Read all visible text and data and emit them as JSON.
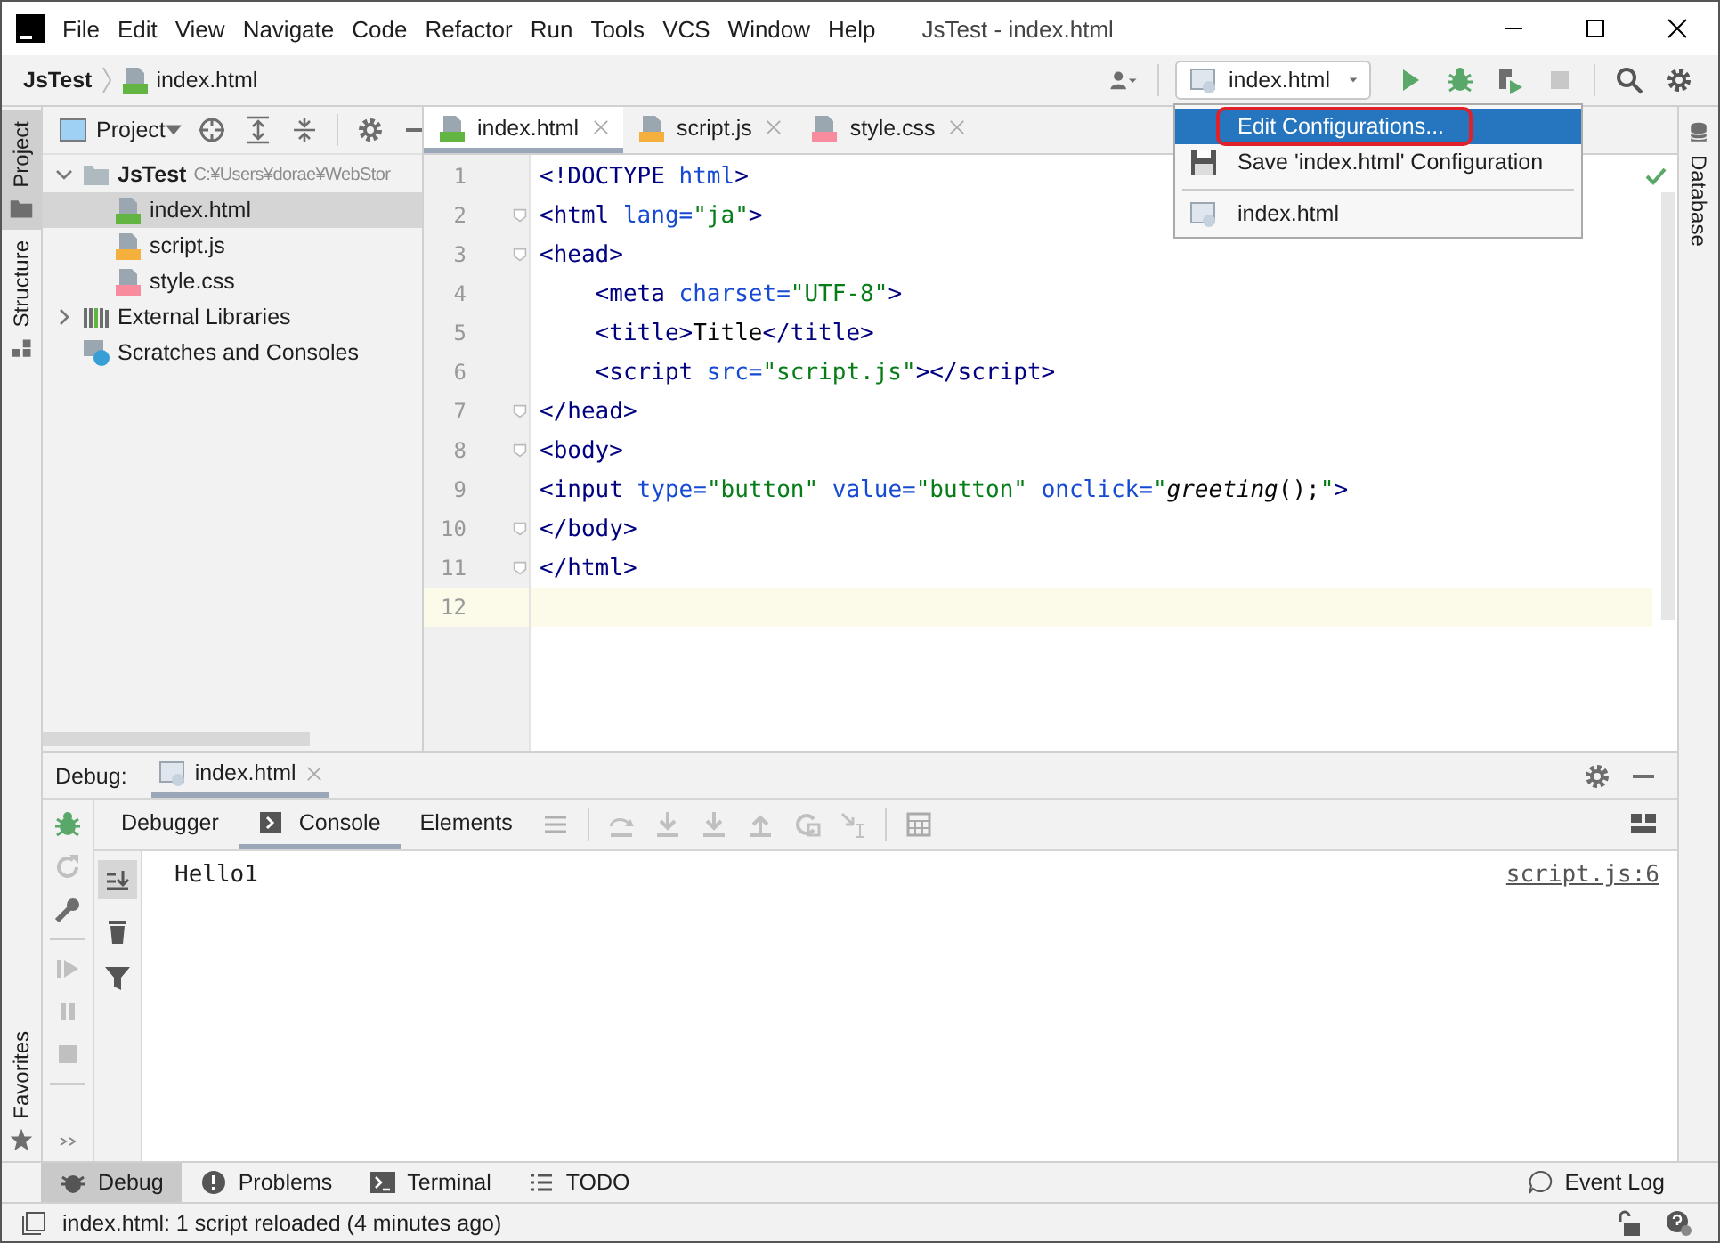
{
  "title_bar": {
    "menu": [
      "File",
      "Edit",
      "View",
      "Navigate",
      "Code",
      "Refactor",
      "Run",
      "Tools",
      "VCS",
      "Window",
      "Help"
    ],
    "title": "JsTest - index.html"
  },
  "nav_bar": {
    "breadcrumbs": [
      {
        "label": "JsTest",
        "kind": "project"
      },
      {
        "label": "index.html",
        "kind": "html"
      }
    ],
    "run_config": "index.html"
  },
  "config_menu": {
    "items": [
      {
        "label": "Edit Configurations...",
        "kind": "action",
        "selected": true,
        "highlighted": true
      },
      {
        "label": "Save 'index.html' Configuration",
        "kind": "save",
        "selected": false,
        "highlighted": false
      },
      {
        "label": "index.html",
        "kind": "config",
        "selected": false,
        "highlighted": false
      }
    ]
  },
  "left_stripe": {
    "tabs": [
      {
        "label": "Project",
        "kind": "project",
        "selected": true
      },
      {
        "label": "Structure",
        "kind": "structure",
        "selected": false
      }
    ],
    "bottom_tab": "Favorites"
  },
  "project_panel": {
    "title": "Project",
    "tree": [
      {
        "label": "JsTest",
        "path": "C:¥Users¥dorae¥WebStor",
        "kind": "folder",
        "expanded": true,
        "selected": false,
        "children": [
          {
            "label": "index.html",
            "kind": "html",
            "selected": true
          },
          {
            "label": "script.js",
            "kind": "js",
            "selected": false
          },
          {
            "label": "style.css",
            "kind": "css",
            "selected": false
          }
        ]
      },
      {
        "label": "External Libraries",
        "kind": "library",
        "expanded": false,
        "selected": false
      },
      {
        "label": "Scratches and Consoles",
        "kind": "scratch",
        "selected": false
      }
    ]
  },
  "editor": {
    "tabs": [
      {
        "label": "index.html",
        "kind": "html",
        "selected": true
      },
      {
        "label": "script.js",
        "kind": "js",
        "selected": false
      },
      {
        "label": "style.css",
        "kind": "css",
        "selected": false
      }
    ],
    "lines": [
      {
        "number": "1",
        "fold": false,
        "current": false,
        "tokens": [
          {
            "t": "<!DOCTYPE ",
            "kind": "tag"
          },
          {
            "t": "html",
            "kind": "attr"
          },
          {
            "t": ">",
            "kind": "tag"
          }
        ]
      },
      {
        "number": "2",
        "fold": true,
        "current": false,
        "tokens": [
          {
            "t": "<html ",
            "kind": "tag"
          },
          {
            "t": "lang=",
            "kind": "attr"
          },
          {
            "t": "\"ja\"",
            "kind": "str"
          },
          {
            "t": ">",
            "kind": "tag"
          }
        ]
      },
      {
        "number": "3",
        "fold": true,
        "current": false,
        "tokens": [
          {
            "t": "<head>",
            "kind": "tag"
          }
        ]
      },
      {
        "number": "4",
        "fold": false,
        "current": false,
        "tokens": [
          {
            "t": "    <meta ",
            "kind": "tag"
          },
          {
            "t": "charset=",
            "kind": "attr"
          },
          {
            "t": "\"UTF-8\"",
            "kind": "str"
          },
          {
            "t": ">",
            "kind": "tag"
          }
        ]
      },
      {
        "number": "5",
        "fold": false,
        "current": false,
        "tokens": [
          {
            "t": "    <title>",
            "kind": "tag"
          },
          {
            "t": "Title",
            "kind": "text"
          },
          {
            "t": "</title>",
            "kind": "tag"
          }
        ]
      },
      {
        "number": "6",
        "fold": false,
        "current": false,
        "tokens": [
          {
            "t": "    <script ",
            "kind": "tag"
          },
          {
            "t": "src=",
            "kind": "attr"
          },
          {
            "t": "\"script.js\"",
            "kind": "str"
          },
          {
            "t": "></script>",
            "kind": "tag"
          }
        ]
      },
      {
        "number": "7",
        "fold": true,
        "current": false,
        "tokens": [
          {
            "t": "</head>",
            "kind": "tag"
          }
        ]
      },
      {
        "number": "8",
        "fold": true,
        "current": false,
        "tokens": [
          {
            "t": "<body>",
            "kind": "tag"
          }
        ]
      },
      {
        "number": "9",
        "fold": false,
        "current": false,
        "tokens": [
          {
            "t": "<input ",
            "kind": "tag"
          },
          {
            "t": "type=",
            "kind": "attr"
          },
          {
            "t": "\"button\" ",
            "kind": "str"
          },
          {
            "t": "value=",
            "kind": "attr"
          },
          {
            "t": "\"button\" ",
            "kind": "str"
          },
          {
            "t": "onclick=",
            "kind": "attr"
          },
          {
            "t": "\"",
            "kind": "str"
          },
          {
            "t": "greeting",
            "kind": "fn"
          },
          {
            "t": "();",
            "kind": "text"
          },
          {
            "t": "\"",
            "kind": "str"
          },
          {
            "t": ">",
            "kind": "tag"
          }
        ]
      },
      {
        "number": "10",
        "fold": true,
        "current": false,
        "tokens": [
          {
            "t": "</body>",
            "kind": "tag"
          }
        ]
      },
      {
        "number": "11",
        "fold": true,
        "current": false,
        "tokens": [
          {
            "t": "</html>",
            "kind": "tag"
          }
        ]
      },
      {
        "number": "12",
        "fold": false,
        "current": true
      }
    ]
  },
  "right_stripe": {
    "tabs": [
      {
        "label": "Database"
      }
    ]
  },
  "debug_panel": {
    "label": "Debug:",
    "session": "index.html",
    "tabs": [
      {
        "label": "Debugger",
        "kind": "plain",
        "selected": false
      },
      {
        "label": "Console",
        "kind": "console",
        "selected": true
      },
      {
        "label": "Elements",
        "kind": "plain",
        "selected": false
      }
    ],
    "console": {
      "output": "Hello1",
      "source": "script.js:6"
    }
  },
  "tool_windows": [
    {
      "label": "Debug",
      "kind": "debug",
      "selected": true
    },
    {
      "label": "Problems",
      "kind": "problems",
      "selected": false
    },
    {
      "label": "Terminal",
      "kind": "terminal",
      "selected": false
    },
    {
      "label": "TODO",
      "kind": "todo",
      "selected": false
    }
  ],
  "event_log": "Event Log",
  "status_bar": {
    "message": "index.html: 1 script reloaded (4 minutes ago)"
  }
}
